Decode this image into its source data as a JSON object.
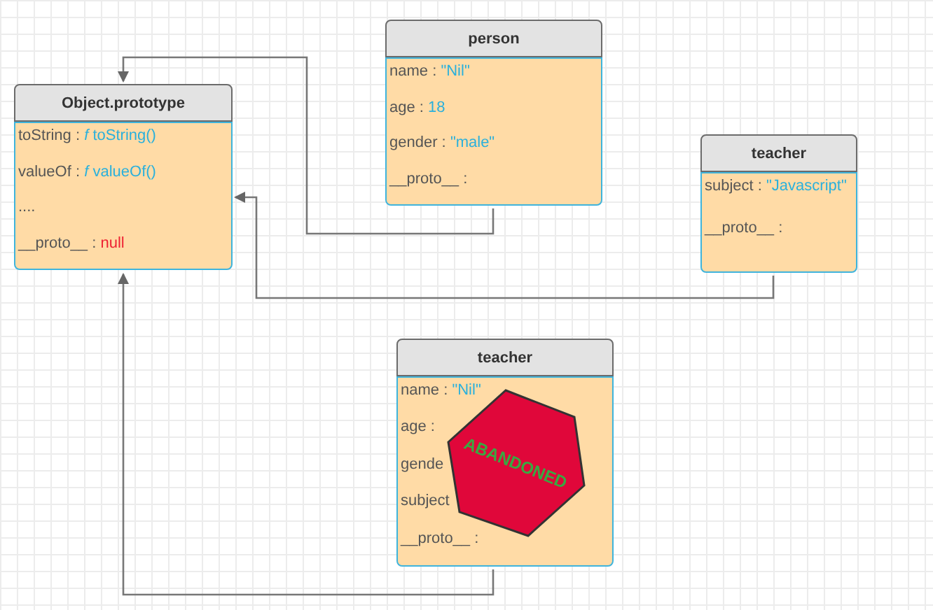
{
  "nodes": [
    {
      "title": "Object.prototype",
      "fields": [
        {
          "key": "toString :",
          "value": "*f* toString()",
          "kind": "value"
        },
        {
          "key": "valueOf :",
          "value": "*f* valueOf()",
          "kind": "value"
        },
        {
          "key": "....",
          "kind": "plain"
        },
        {
          "key": "__proto__ :",
          "value": "null",
          "kind": "null"
        }
      ]
    },
    {
      "title": "person",
      "fields": [
        {
          "key": "name :",
          "value": "\"Nil\"",
          "kind": "value"
        },
        {
          "key": "age :",
          "value": "18",
          "kind": "value"
        },
        {
          "key": "gender :",
          "value": "\"male\"",
          "kind": "value"
        },
        {
          "key": "__proto__ :",
          "kind": "plain"
        }
      ]
    },
    {
      "title": "teacher",
      "fields": [
        {
          "key": "subject :",
          "value": "\"Javascript\"",
          "kind": "value"
        },
        {
          "key": "__proto__ :",
          "kind": "plain"
        }
      ]
    },
    {
      "title": "teacher",
      "fields": [
        {
          "key": "name :",
          "value": "\"Nil\"",
          "kind": "value"
        },
        {
          "key": "age :",
          "kind": "plain"
        },
        {
          "key": "gende",
          "kind": "plain"
        },
        {
          "key": "subject",
          "kind": "plain"
        },
        {
          "key": "__proto__ :",
          "kind": "plain"
        }
      ]
    }
  ],
  "stamp": {
    "text": "ABANDONED"
  }
}
